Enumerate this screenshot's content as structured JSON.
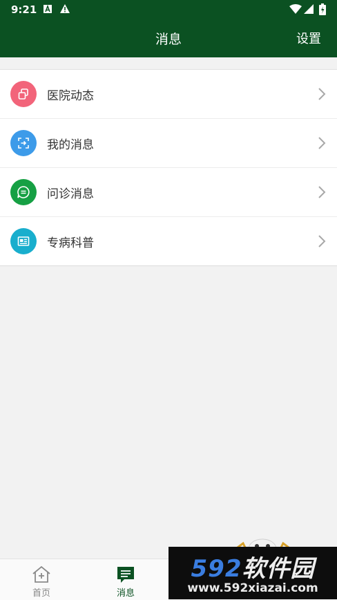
{
  "status_bar": {
    "time": "9:21"
  },
  "app_bar": {
    "title": "消息",
    "settings_label": "设置"
  },
  "menu": [
    {
      "label": "医院动态",
      "icon": "hospital-news-icon",
      "color": "#f2647a"
    },
    {
      "label": "我的消息",
      "icon": "my-message-icon",
      "color": "#3d9be9"
    },
    {
      "label": "问诊消息",
      "icon": "chat-bubble-icon",
      "color": "#16a044"
    },
    {
      "label": "专病科普",
      "icon": "newspaper-icon",
      "color": "#19aecd"
    }
  ],
  "tabs": [
    {
      "label": "首页",
      "icon": "home-icon",
      "active": false
    },
    {
      "label": "消息",
      "icon": "message-icon",
      "active": true
    }
  ],
  "watermark": {
    "logo_num": "592",
    "logo_text": "软件园",
    "url": "www.592xiazai.com"
  },
  "colors": {
    "primary": "#0b5122",
    "background": "#f2f2f2",
    "tab_inactive": "#888888"
  }
}
